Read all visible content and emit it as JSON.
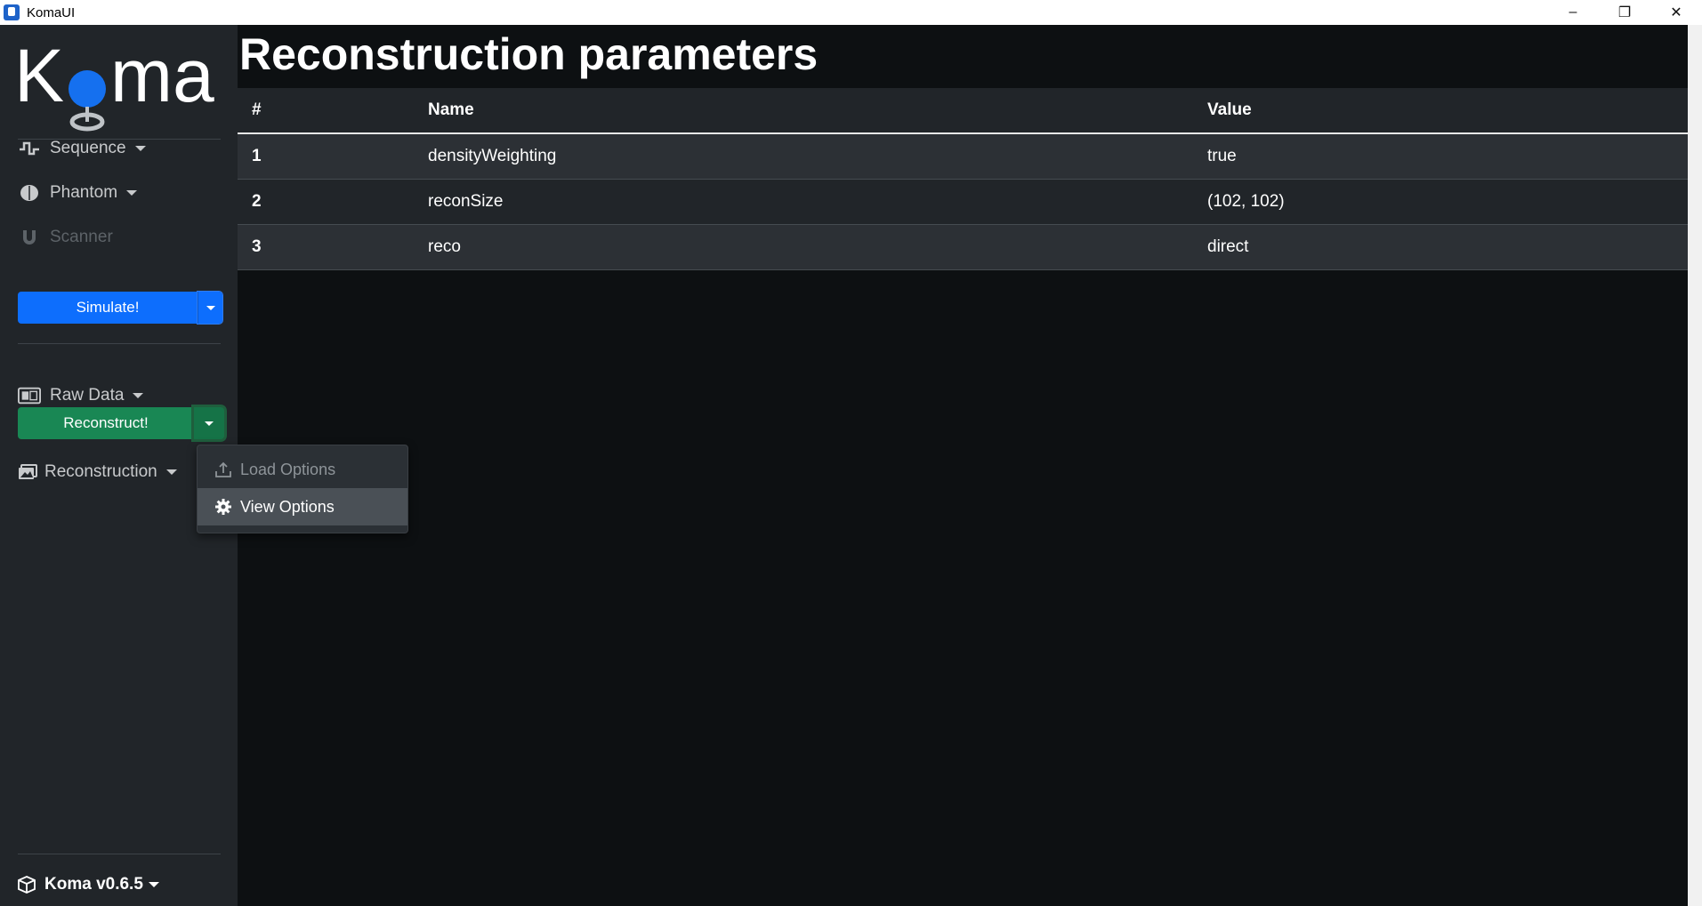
{
  "window": {
    "title": "KomaUI",
    "minimize": "–",
    "restore": "❐",
    "close": "✕"
  },
  "logo": {
    "text_left": "K",
    "text_right": "ma",
    "accent": "#1570ef"
  },
  "sidebar": {
    "sequence_label": "Sequence",
    "phantom_label": "Phantom",
    "scanner_label": "Scanner",
    "simulate_label": "Simulate!",
    "rawdata_label": "Raw Data",
    "reconstruct_label": "Reconstruct!",
    "reconstruction_label": "Reconstruction",
    "footer_label": "Koma v0.6.5",
    "colors": {
      "simulate": "#0d6efd",
      "reconstruct": "#198754"
    }
  },
  "dropdown": {
    "items": [
      {
        "label": "Load Options",
        "icon": "upload-icon",
        "state": "disabled"
      },
      {
        "label": "View Options",
        "icon": "gear-icon",
        "state": "active"
      }
    ]
  },
  "main": {
    "title": "Reconstruction parameters",
    "table": {
      "headers": [
        "#",
        "Name",
        "Value"
      ],
      "rows": [
        {
          "num": "1",
          "name": "densityWeighting",
          "value": "true"
        },
        {
          "num": "2",
          "name": "reconSize",
          "value": "(102, 102)"
        },
        {
          "num": "3",
          "name": "reco",
          "value": "direct"
        }
      ]
    }
  }
}
